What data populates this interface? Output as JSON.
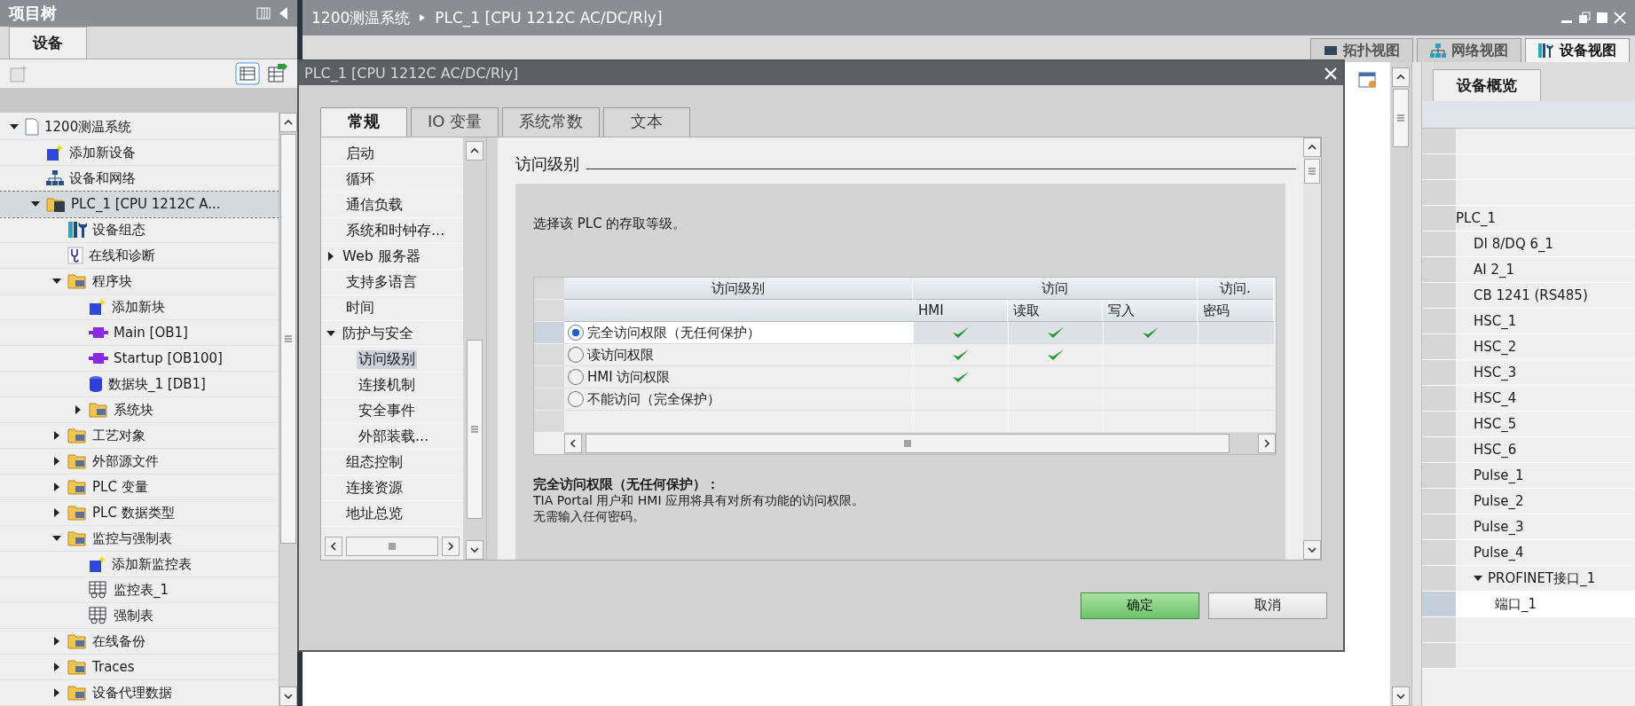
{
  "project_tree": {
    "title": "项目树",
    "tab": "设备",
    "items": [
      {
        "label": "1200测温系统",
        "kind": "project",
        "expanded": true,
        "selected": false,
        "children": [
          {
            "label": "添加新设备",
            "kind": "add",
            "selected": false
          },
          {
            "label": "设备和网络",
            "kind": "network",
            "selected": false
          },
          {
            "label": "PLC_1 [CPU 1212C A...",
            "kind": "plc",
            "expanded": true,
            "selected": true,
            "children": [
              {
                "label": "设备组态",
                "kind": "config",
                "selected": false
              },
              {
                "label": "在线和诊断",
                "kind": "diag",
                "selected": false
              },
              {
                "label": "程序块",
                "kind": "folder",
                "expanded": true,
                "selected": false,
                "children": [
                  {
                    "label": "添加新块",
                    "kind": "add",
                    "selected": false
                  },
                  {
                    "label": "Main [OB1]",
                    "kind": "block",
                    "selected": false
                  },
                  {
                    "label": "Startup [OB100]",
                    "kind": "block",
                    "selected": false
                  },
                  {
                    "label": "数据块_1 [DB1]",
                    "kind": "db",
                    "selected": false
                  },
                  {
                    "label": "系统块",
                    "kind": "folder",
                    "expanded": false,
                    "selected": false
                  }
                ]
              },
              {
                "label": "工艺对象",
                "kind": "folder",
                "expanded": false,
                "selected": false
              },
              {
                "label": "外部源文件",
                "kind": "folder",
                "expanded": false,
                "selected": false
              },
              {
                "label": "PLC 变量",
                "kind": "folder",
                "expanded": false,
                "selected": false
              },
              {
                "label": "PLC 数据类型",
                "kind": "folder",
                "expanded": false,
                "selected": false
              },
              {
                "label": "监控与强制表",
                "kind": "folder",
                "expanded": true,
                "selected": false,
                "children": [
                  {
                    "label": "添加新监控表",
                    "kind": "add",
                    "selected": false
                  },
                  {
                    "label": "监控表_1",
                    "kind": "table",
                    "selected": false
                  },
                  {
                    "label": "强制表",
                    "kind": "table",
                    "selected": false
                  }
                ]
              },
              {
                "label": "在线备份",
                "kind": "folder",
                "expanded": false,
                "selected": false
              },
              {
                "label": "Traces",
                "kind": "folder",
                "expanded": false,
                "selected": false
              },
              {
                "label": "设备代理数据",
                "kind": "folder",
                "expanded": false,
                "selected": false
              }
            ]
          }
        ]
      }
    ]
  },
  "editor": {
    "breadcrumb": [
      "1200测温系统",
      "PLC_1 [CPU 1212C AC/DC/Rly]"
    ],
    "view_tabs": [
      {
        "label": "拓扑视图",
        "selected": false
      },
      {
        "label": "网络视图",
        "selected": false
      },
      {
        "label": "设备视图",
        "selected": true
      }
    ]
  },
  "dialog": {
    "title": "PLC_1 [CPU 1212C AC/DC/Rly]",
    "tabs": [
      {
        "label": "常规",
        "selected": true
      },
      {
        "label": "IO 变量",
        "selected": false
      },
      {
        "label": "系统常数",
        "selected": false
      },
      {
        "label": "文本",
        "selected": false
      }
    ],
    "nav": [
      {
        "label": "启动",
        "selected": false
      },
      {
        "label": "循环",
        "selected": false
      },
      {
        "label": "通信负载",
        "selected": false
      },
      {
        "label": "系统和时钟存...",
        "selected": false
      },
      {
        "label": "Web 服务器",
        "expanded": false,
        "selected": false
      },
      {
        "label": "支持多语言",
        "selected": false
      },
      {
        "label": "时间",
        "selected": false
      },
      {
        "label": "防护与安全",
        "expanded": true,
        "selected": false,
        "children": [
          {
            "label": "访问级别",
            "selected": true
          },
          {
            "label": "连接机制",
            "selected": false
          },
          {
            "label": "安全事件",
            "selected": false
          },
          {
            "label": "外部装载...",
            "selected": false
          }
        ]
      },
      {
        "label": "组态控制",
        "selected": false
      },
      {
        "label": "连接资源",
        "selected": false
      },
      {
        "label": "地址总览",
        "selected": false
      }
    ],
    "section_title": "访问级别",
    "prompt": "选择该 PLC 的存取等级。",
    "table": {
      "group_headers": [
        "访问级别",
        "访问",
        "访问."
      ],
      "columns": [
        "HMI",
        "读取",
        "写入",
        "密码"
      ],
      "rows": [
        {
          "label": "完全访问权限（无任何保护）",
          "selected": true,
          "hmi": true,
          "read": true,
          "write": true
        },
        {
          "label": "读访问权限",
          "selected": false,
          "hmi": true,
          "read": true,
          "write": false
        },
        {
          "label": "HMI 访问权限",
          "selected": false,
          "hmi": true,
          "read": false,
          "write": false
        },
        {
          "label": "不能访问（完全保护）",
          "selected": false,
          "hmi": false,
          "read": false,
          "write": false
        }
      ]
    },
    "description_title": "完全访问权限（无任何保护）：",
    "description_lines": [
      "TIA Portal 用户和 HMI 应用将具有对所有功能的访问权限。",
      "无需输入任何密码。"
    ],
    "buttons": [
      {
        "label": "确定",
        "kind": "primary"
      },
      {
        "label": "取消",
        "kind": "secondary"
      }
    ]
  },
  "device_overview": {
    "tab": "设备概览",
    "rows": [
      {
        "label": "",
        "selected": false
      },
      {
        "label": "",
        "selected": false
      },
      {
        "label": "",
        "selected": false
      },
      {
        "label": "PLC_1",
        "kind": "top",
        "selected": false
      },
      {
        "label": "DI 8/DQ 6_1",
        "kind": "item",
        "selected": false
      },
      {
        "label": "AI 2_1",
        "kind": "item",
        "selected": false
      },
      {
        "label": "CB 1241 (RS485)",
        "kind": "item",
        "selected": false
      },
      {
        "label": "HSC_1",
        "kind": "item",
        "selected": false
      },
      {
        "label": "HSC_2",
        "kind": "item",
        "selected": false
      },
      {
        "label": "HSC_3",
        "kind": "item",
        "selected": false
      },
      {
        "label": "HSC_4",
        "kind": "item",
        "selected": false
      },
      {
        "label": "HSC_5",
        "kind": "item",
        "selected": false
      },
      {
        "label": "HSC_6",
        "kind": "item",
        "selected": false
      },
      {
        "label": "Pulse_1",
        "kind": "item",
        "selected": false
      },
      {
        "label": "Pulse_2",
        "kind": "item",
        "selected": false
      },
      {
        "label": "Pulse_3",
        "kind": "item",
        "selected": false
      },
      {
        "label": "Pulse_4",
        "kind": "item",
        "selected": false
      },
      {
        "label": "PROFINET接口_1",
        "kind": "group",
        "expanded": true,
        "selected": false
      },
      {
        "label": "端口_1",
        "kind": "sub",
        "selected": true
      },
      {
        "label": "",
        "selected": false
      },
      {
        "label": "",
        "selected": false
      }
    ]
  }
}
